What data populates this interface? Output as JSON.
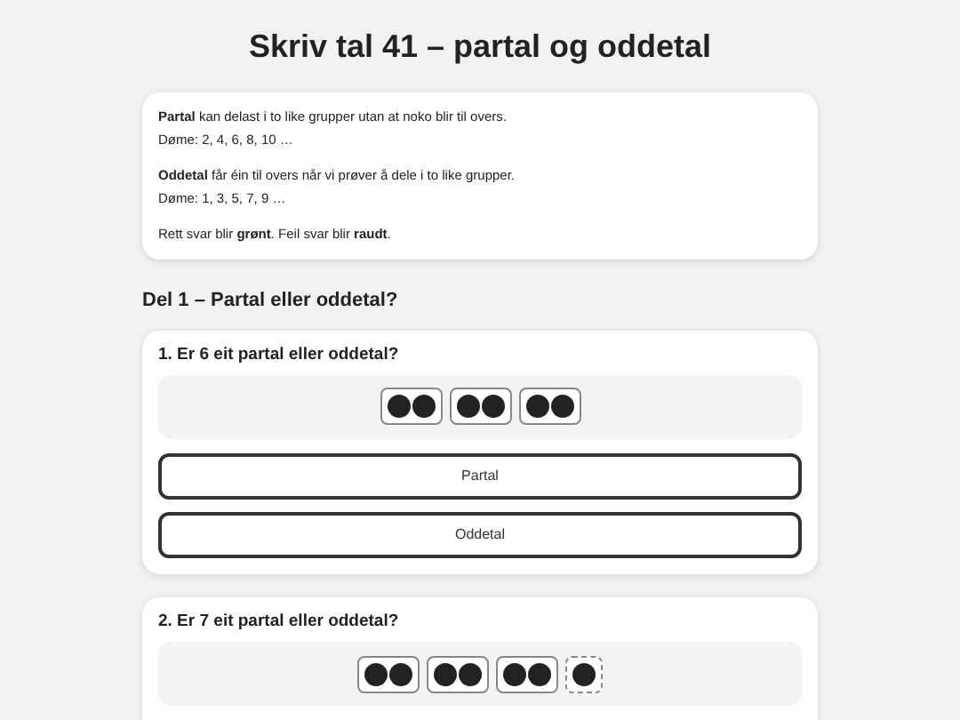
{
  "title": "Skriv tal 41 – partal og oddetal",
  "info": {
    "paragraphs": [
      [
        "**Partal** kan delast i to like grupper utan at noko blir til overs.",
        "Døme: 2, 4, 6, 8, 10 …"
      ],
      [
        "**Oddetal** får éin til overs når vi prøver å dele i to like grupper.",
        "Døme: 1, 3, 5, 7, 9 …"
      ],
      [
        "Rett svar blir **grønt**. Feil svar blir **raudt**."
      ]
    ]
  },
  "section": "Del 1 – Partal eller oddetal?",
  "questions": [
    {
      "question": "1. Er 6 eit partal eller oddetal?",
      "groups": [
        {
          "kind": "pair"
        },
        {
          "kind": "pair"
        },
        {
          "kind": "pair"
        }
      ],
      "answers": [
        "Partal",
        "Oddetal"
      ]
    },
    {
      "question": "2. Er 7 eit partal eller oddetal?",
      "groups": [
        {
          "kind": "pair"
        },
        {
          "kind": "pair"
        },
        {
          "kind": "pair"
        },
        {
          "kind": "single"
        }
      ]
    }
  ]
}
